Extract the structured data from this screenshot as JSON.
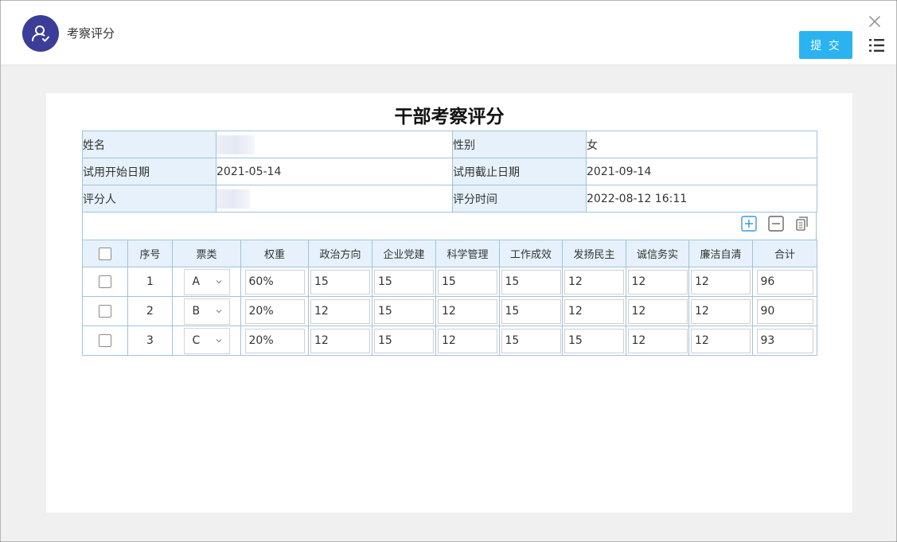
{
  "header": {
    "title": "考察评分",
    "submit_label": "提 交"
  },
  "doc": {
    "title": "干部考察评分"
  },
  "info": {
    "name_label": "姓名",
    "name_value": "",
    "gender_label": "性别",
    "gender_value": "女",
    "trial_start_label": "试用开始日期",
    "trial_start_value": "2021-05-14",
    "trial_end_label": "试用截止日期",
    "trial_end_value": "2021-09-14",
    "rater_label": "评分人",
    "rater_value": "",
    "rate_time_label": "评分时间",
    "rate_time_value": "2022-08-12 16:11"
  },
  "grid": {
    "columns": [
      "序号",
      "票类",
      "权重",
      "政治方向",
      "企业党建",
      "科学管理",
      "工作成效",
      "发扬民主",
      "诚信务实",
      "廉洁自清",
      "合计"
    ],
    "rows": [
      {
        "seq": "1",
        "type": "A",
        "weight": "60%",
        "zzfx": "15",
        "qydj": "15",
        "kxgl": "15",
        "gzcx": "15",
        "fymz": "12",
        "cxws": "12",
        "ljzq": "12",
        "total": "96"
      },
      {
        "seq": "2",
        "type": "B",
        "weight": "20%",
        "zzfx": "12",
        "qydj": "15",
        "kxgl": "12",
        "gzcx": "15",
        "fymz": "12",
        "cxws": "12",
        "ljzq": "12",
        "total": "90"
      },
      {
        "seq": "3",
        "type": "C",
        "weight": "20%",
        "zzfx": "12",
        "qydj": "15",
        "kxgl": "12",
        "gzcx": "15",
        "fymz": "15",
        "cxws": "12",
        "ljzq": "12",
        "total": "93"
      }
    ]
  },
  "icons": {
    "avatar": "user-check-icon",
    "close": "close-icon",
    "menu": "list-menu-icon",
    "add_row": "plus-box-icon",
    "remove_row": "minus-box-icon",
    "copy_row": "copy-icon",
    "select_chevron": "chevron-down-icon"
  },
  "colors": {
    "accent": "#2ab3f0",
    "avatar_bg": "#3b3d98",
    "label_bg": "#e6f1fb",
    "border": "#9ec4dc"
  }
}
